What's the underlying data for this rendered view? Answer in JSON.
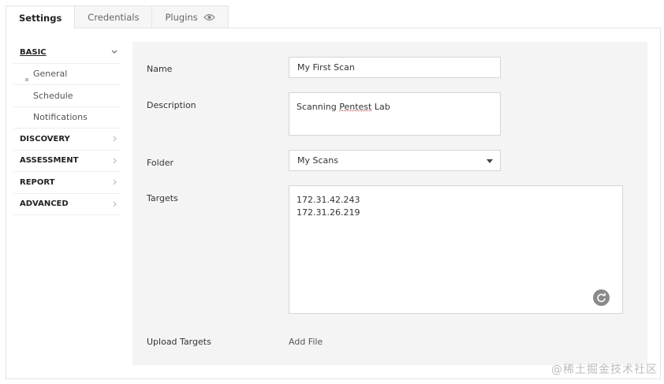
{
  "tabs": [
    {
      "label": "Settings"
    },
    {
      "label": "Credentials"
    },
    {
      "label": "Plugins"
    }
  ],
  "sidebar": {
    "basic": "BASIC",
    "items": [
      {
        "label": "General"
      },
      {
        "label": "Schedule"
      },
      {
        "label": "Notifications"
      }
    ],
    "sections": [
      {
        "label": "DISCOVERY"
      },
      {
        "label": "ASSESSMENT"
      },
      {
        "label": "REPORT"
      },
      {
        "label": "ADVANCED"
      }
    ]
  },
  "form": {
    "name_label": "Name",
    "name_value": "My First Scan",
    "description_label": "Description",
    "description_pre": "Scanning ",
    "description_misspelled": "Pentest",
    "description_post": " Lab",
    "folder_label": "Folder",
    "folder_value": "My Scans",
    "targets_label": "Targets",
    "targets_lines": [
      "172.31.42.243",
      "172.31.26.219"
    ],
    "upload_label": "Upload Targets",
    "add_file": "Add File"
  },
  "watermark": "@稀土掘金技术社区",
  "icons": {
    "plugins_tab": "eye-icon",
    "expand": "chevron-down-icon",
    "collapsed": "chevron-right-icon",
    "targets_tool": "refresh-icon",
    "folder_select": "caret-down-icon"
  }
}
